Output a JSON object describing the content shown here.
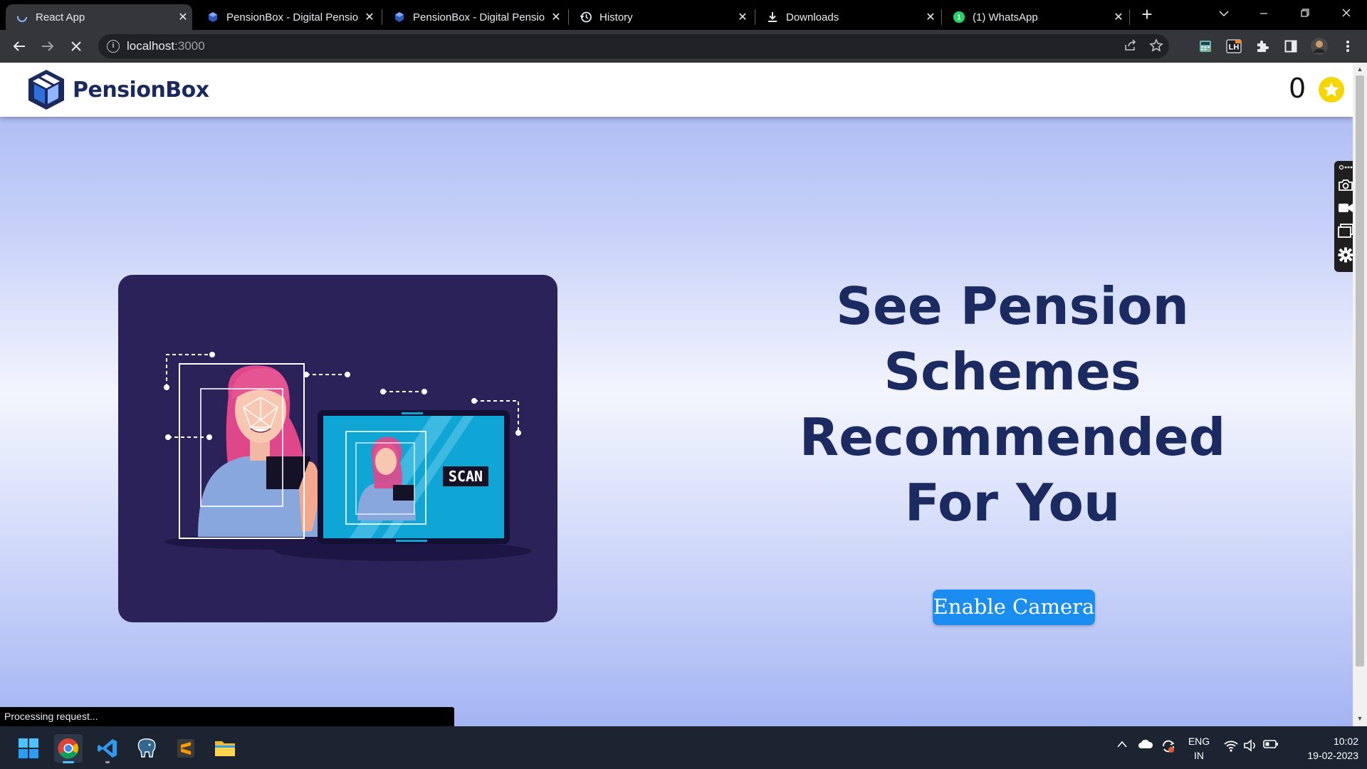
{
  "browser": {
    "tabs": [
      {
        "title": "React App",
        "active": true,
        "icon": "react-spinner-icon"
      },
      {
        "title": "PensionBox - Digital Pensio",
        "active": false,
        "icon": "pensionbox-icon"
      },
      {
        "title": "PensionBox - Digital Pensio",
        "active": false,
        "icon": "pensionbox-icon"
      },
      {
        "title": "History",
        "active": false,
        "icon": "history-icon"
      },
      {
        "title": "Downloads",
        "active": false,
        "icon": "download-icon"
      },
      {
        "title": "(1) WhatsApp",
        "active": false,
        "icon": "whatsapp-icon"
      }
    ],
    "tab_close": "✕",
    "new_tab": "+",
    "url_host": "localhost",
    "url_port": ":3000"
  },
  "navbar": {
    "brand": "PensionBox",
    "counter": "0"
  },
  "hero": {
    "headline_lines": [
      "See Pension",
      "Schemes",
      "Recommended",
      "For You"
    ],
    "scan_label": "SCAN",
    "cta": "Enable Camera"
  },
  "status_bar": "Processing request...",
  "taskbar": {
    "lang_1": "ENG",
    "lang_2": "IN",
    "time": "10:02",
    "date": "19-02-2023"
  },
  "colors": {
    "brand_navy": "#1c2a62",
    "cta_blue": "#1b8df0",
    "star_yellow": "#f7d600",
    "card_purple": "#2a2259"
  }
}
